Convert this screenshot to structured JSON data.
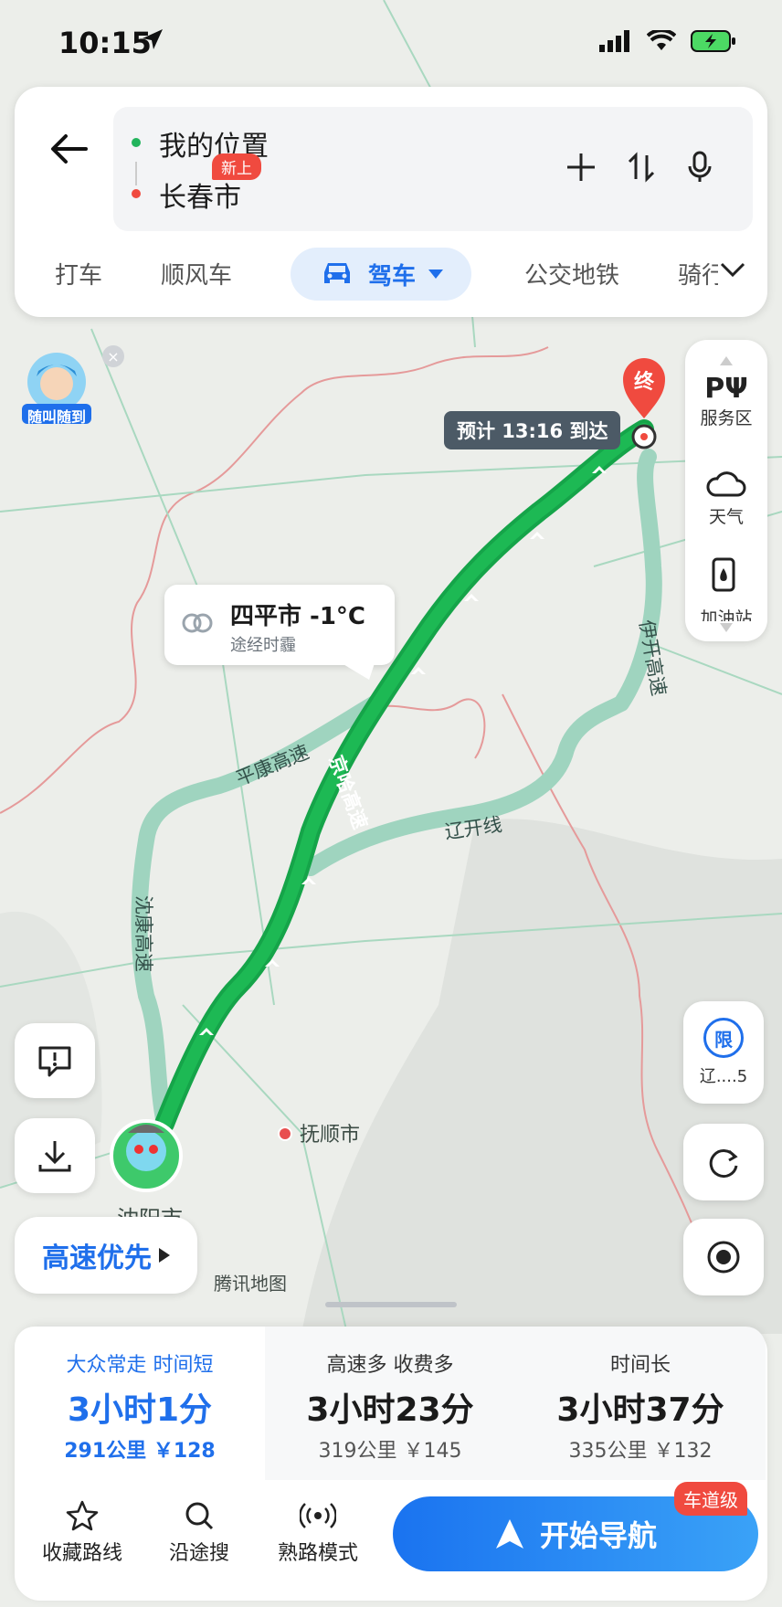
{
  "status_bar": {
    "time": "10:15"
  },
  "search": {
    "origin": "我的位置",
    "destination": "长春市"
  },
  "tabs": [
    {
      "label": "打车"
    },
    {
      "label": "顺风车",
      "badge": "新上"
    },
    {
      "label": "驾车",
      "active": true
    },
    {
      "label": "公交地铁"
    },
    {
      "label": "骑行"
    }
  ],
  "avatar": {
    "label": "随叫随到"
  },
  "right_panel": {
    "service": "服务区",
    "weather": "天气",
    "gas": "加油站"
  },
  "map": {
    "eta": "预计 13:16 到达",
    "end_marker": "终",
    "weather": {
      "city_temp": "四平市 -1°C",
      "condition": "途经时霾"
    },
    "roads": {
      "r1": "平康高速",
      "r2": "京哈高速",
      "r3": "辽开线",
      "r4": "伊开高速",
      "r5": "沈康高速"
    },
    "cities": {
      "fushun": "抚顺市",
      "shenyang": "沈阳市"
    },
    "provider": "腾讯地图"
  },
  "right_controls": {
    "limit_icon": "限",
    "limit_label": "辽....5"
  },
  "preference": "高速优先",
  "routes": [
    {
      "tag": "大众常走 时间短",
      "time": "3小时1分",
      "dist": "291公里 ￥128",
      "selected": true
    },
    {
      "tag": "高速多 收费多",
      "time": "3小时23分",
      "dist": "319公里 ￥145"
    },
    {
      "tag": "时间长",
      "time": "3小时37分",
      "dist": "335公里 ￥132"
    }
  ],
  "actions": {
    "fav": "收藏路线",
    "search": "沿途搜",
    "familiar": "熟路模式"
  },
  "navigate": {
    "label": "开始导航",
    "badge": "车道级"
  },
  "colors": {
    "route": "#1db954",
    "alt_route": "#9fd4bf",
    "accent": "#1f6feb",
    "badge": "#f04a3f"
  }
}
